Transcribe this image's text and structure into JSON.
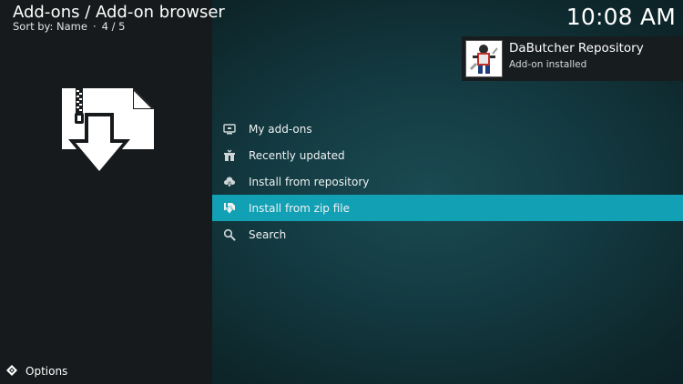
{
  "header": {
    "title": "Add-ons / Add-on browser",
    "sort_label": "Sort by: Name",
    "position": "4 / 5"
  },
  "clock": "10:08 AM",
  "notification": {
    "title": "DaButcher Repository",
    "message": "Add-on installed",
    "thumbnail_icon": "repository-thumbnail"
  },
  "hero_icon": "zip-install-icon",
  "menu": {
    "items": [
      {
        "label": "My add-ons",
        "icon": "monitor-icon",
        "focused": false
      },
      {
        "label": "Recently updated",
        "icon": "box-update-icon",
        "focused": false
      },
      {
        "label": "Install from repository",
        "icon": "cloud-download-icon",
        "focused": false
      },
      {
        "label": "Install from zip file",
        "icon": "zip-icon",
        "focused": true
      },
      {
        "label": "Search",
        "icon": "search-icon",
        "focused": false
      }
    ]
  },
  "footer": {
    "options_label": "Options",
    "options_icon": "options-icon"
  },
  "colors": {
    "focus": "#12a0b4",
    "left_panel": "#161a1c",
    "background_center": "#1b4a52"
  }
}
